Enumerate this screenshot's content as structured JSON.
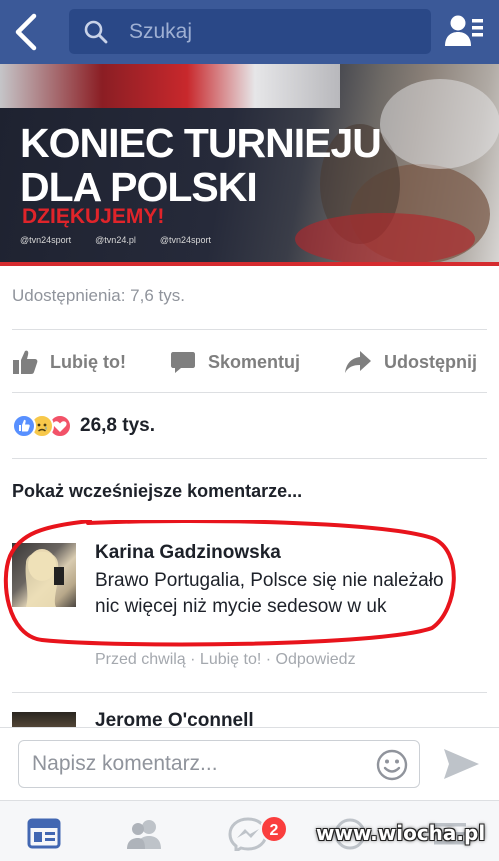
{
  "header": {
    "search_placeholder": "Szukaj",
    "icons": [
      "back-icon",
      "search-icon",
      "friend-requests-icon"
    ],
    "bar_color": "#3b5998"
  },
  "post": {
    "banner": {
      "title_line1": "KONIEC TURNIEJU",
      "title_line2": "DLA POLSKI",
      "subtitle": "DZIĘKUJEMY!",
      "socials": [
        "@tvn24sport",
        "@tvn24.pl",
        "@tvn24sport"
      ],
      "accent_color": "#e0242a"
    },
    "shares": "Udostępnienia: 7,6 tys.",
    "actions": {
      "like": "Lubię to!",
      "comment": "Skomentuj",
      "share": "Udostępnij"
    },
    "reactions": {
      "icons": [
        "like-reaction-icon",
        "sad-reaction-icon",
        "love-reaction-icon"
      ],
      "count": "26,8 tys."
    }
  },
  "comments": {
    "show_previous": "Pokaż wcześniejsze komentarze...",
    "items": [
      {
        "author": "Karina Gadzinowska",
        "text": "Brawo Portugalia, Polsce się nie należało nic więcej niż mycie sedesow w uk",
        "meta": "Przed chwilą · Lubię to! · Odpowiedz"
      },
      {
        "author": "Jerome O'connell"
      }
    ]
  },
  "composer": {
    "placeholder": "Napisz komentarz..."
  },
  "tabbar": {
    "tabs": [
      "news-feed-icon",
      "friends-icon",
      "messenger-icon",
      "globe-icon",
      "menu-icon"
    ],
    "messenger_badge": "2"
  },
  "watermark": "www.wiocha.pl"
}
